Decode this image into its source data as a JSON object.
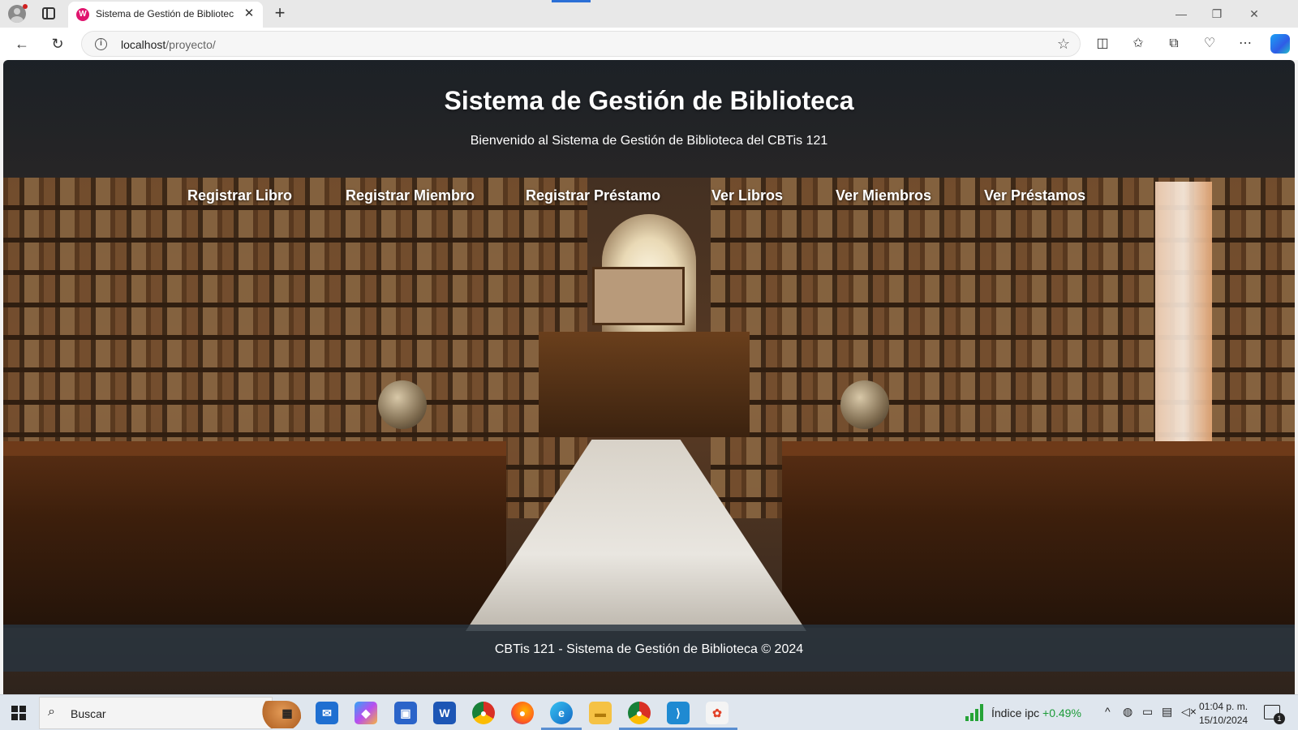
{
  "browser": {
    "tab_title": "Sistema de Gestión de Biblioteca",
    "tab_favicon": "W",
    "url_host": "localhost",
    "url_path": "/proyecto/"
  },
  "page": {
    "title": "Sistema de Gestión de Biblioteca",
    "subtitle": "Bienvenido al Sistema de Gestión de Biblioteca del CBTis 121",
    "nav": [
      {
        "label": "Registrar Libro"
      },
      {
        "label": "Registrar Miembro"
      },
      {
        "label": "Registrar Préstamo"
      },
      {
        "label": "Ver Libros"
      },
      {
        "label": "Ver Miembros"
      },
      {
        "label": "Ver Préstamos"
      }
    ],
    "footer": "CBTis 121 - Sistema de Gestión de Biblioteca © 2024"
  },
  "taskbar": {
    "search_label": "Buscar",
    "apps": [
      {
        "icon": "task-view-icon",
        "glyph": "▦"
      },
      {
        "icon": "mail-icon",
        "glyph": "✉"
      },
      {
        "icon": "copilot-icon",
        "glyph": "◆"
      },
      {
        "icon": "store-icon",
        "glyph": "▣"
      },
      {
        "icon": "word-icon",
        "glyph": "W"
      },
      {
        "icon": "chrome-icon",
        "glyph": "●"
      },
      {
        "icon": "firefox-icon",
        "glyph": "●"
      },
      {
        "icon": "edge-icon",
        "glyph": "e"
      },
      {
        "icon": "folder-icon",
        "glyph": "▬"
      },
      {
        "icon": "chrome-icon",
        "glyph": "●"
      },
      {
        "icon": "vscode-icon",
        "glyph": "⟩"
      },
      {
        "icon": "xampp-icon",
        "glyph": "✿"
      }
    ],
    "widget_label": "Índice ipc",
    "widget_value": "+0.49%",
    "time": "01:04 p. m.",
    "date": "15/10/2024",
    "notification_count": "1"
  },
  "colors": {
    "accent": "#2b6fd6",
    "header_overlay": "#141e28",
    "footer_bg": "#283440",
    "text_on_image": "#ffffff",
    "positive": "#1c9b38"
  }
}
